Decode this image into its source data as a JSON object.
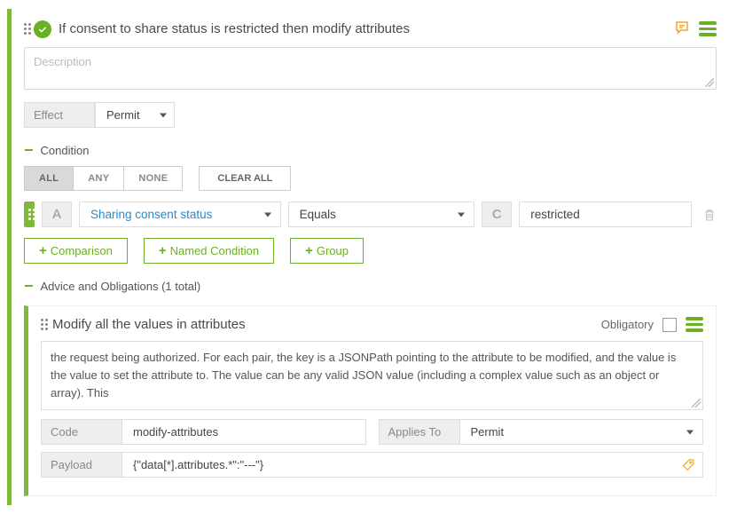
{
  "rule": {
    "title": "If consent to share status is restricted then modify attributes",
    "description_placeholder": "Description",
    "effect": {
      "label": "Effect",
      "value": "Permit"
    }
  },
  "condition": {
    "heading": "Condition",
    "combinators": {
      "all": "ALL",
      "any": "ANY",
      "none": "NONE"
    },
    "clear_label": "CLEAR ALL",
    "row": {
      "attr_tag": "A",
      "attribute": "Sharing consent status",
      "operator": "Equals",
      "value_tag": "C",
      "value": "restricted"
    },
    "add": {
      "comparison": "Comparison",
      "named": "Named Condition",
      "group": "Group"
    }
  },
  "advice": {
    "heading": "Advice and Obligations (1 total)",
    "item": {
      "title": "Modify all the values in attributes",
      "obligatory_label": "Obligatory",
      "description": "the request being authorized. For each pair, the key is a JSONPath pointing to the attribute to be modified, and the value is the value to set the attribute to. The value can be any valid JSON value (including a complex value such as an object or array). This",
      "code": {
        "label": "Code",
        "value": "modify-attributes"
      },
      "applies_to": {
        "label": "Applies To",
        "value": "Permit"
      },
      "payload": {
        "label": "Payload",
        "value": "{\"data[*].attributes.*\":\"---\"}"
      }
    }
  }
}
